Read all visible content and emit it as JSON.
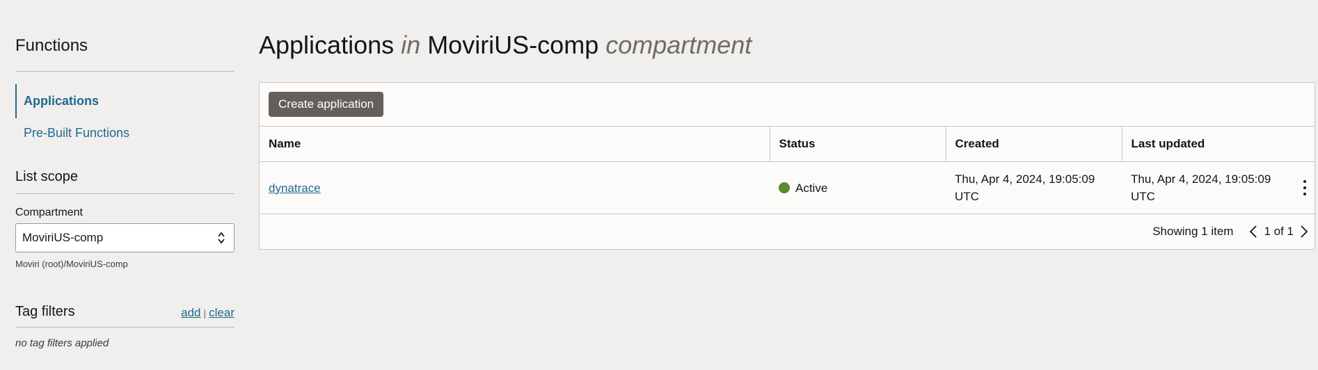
{
  "sidebar": {
    "title": "Functions",
    "nav": [
      {
        "label": "Applications",
        "active": true
      },
      {
        "label": "Pre-Built Functions",
        "active": false
      }
    ],
    "list_scope": {
      "title": "List scope",
      "compartment_label": "Compartment",
      "compartment_value": "MoviriUS-comp",
      "compartment_path": "Moviri (root)/MoviriUS-comp"
    },
    "tag_filters": {
      "title": "Tag filters",
      "add_label": "add",
      "separator": "|",
      "clear_label": "clear",
      "empty_text": "no tag filters applied"
    }
  },
  "main": {
    "title": {
      "part1": "Applications",
      "part2": "in",
      "part3": "MoviriUS-comp",
      "part4": "compartment"
    },
    "create_button_label": "Create application",
    "table": {
      "columns": [
        "Name",
        "Status",
        "Created",
        "Last updated"
      ],
      "rows": [
        {
          "name": "dynatrace",
          "status": "Active",
          "created": "Thu, Apr 4, 2024, 19:05:09 UTC",
          "last_updated": "Thu, Apr 4, 2024, 19:05:09 UTC"
        }
      ]
    },
    "pagination": {
      "showing": "Showing 1 item",
      "page": "1 of 1"
    }
  },
  "icons": {
    "select": "chevron-up-down-icon",
    "row_actions": "more-vertical-icon",
    "prev": "chevron-left-icon",
    "next": "chevron-right-icon"
  },
  "colors": {
    "background": "#f1efed",
    "link": "#1e6a8c",
    "primary_button": "#665f59",
    "status_active": "#5e8a2e"
  }
}
